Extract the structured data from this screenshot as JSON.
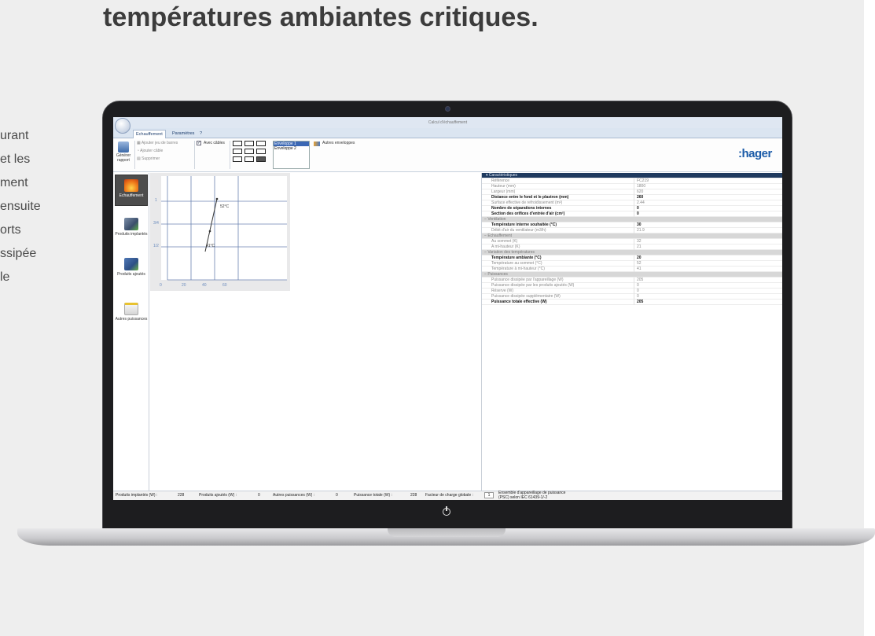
{
  "headline": "températures ambiantes critiques.",
  "left_text": [
    "urant",
    "et les",
    "ment",
    "ensuite",
    "orts",
    "ssipée",
    "le"
  ],
  "app": {
    "window_title": "Calcul d'échauffement",
    "tabs": [
      "Echauffement",
      "Paramètres",
      "?"
    ],
    "ribbon": {
      "generer_rapport": "Générer rapport",
      "ajouter_jeu_barres": "Ajouter jeu de barres",
      "ajouter_cable": "Ajouter câble",
      "supprimer": "Supprimer",
      "avec_cables": "Avec câbles",
      "enveloppes": [
        "Enveloppe 1",
        "Enveloppe 2"
      ],
      "autres_enveloppes": "Autres enveloppes",
      "logo": ":hager"
    },
    "sidebar": [
      {
        "label": "Echauffement",
        "icon": "flame-icon"
      },
      {
        "label": "Produits implantés",
        "icon": "products-implanted-icon"
      },
      {
        "label": "Produits ajoutés",
        "icon": "products-added-icon"
      },
      {
        "label": "Autres puissances",
        "icon": "folder-plus-icon"
      }
    ],
    "chart": {
      "y_ticks": [
        "1",
        "3/4",
        "1/2"
      ],
      "x_ticks": [
        "0",
        "20",
        "40",
        "60"
      ],
      "annotations": [
        "52°C",
        "41°C"
      ]
    },
    "properties": {
      "header": "Caractéristiques",
      "rows": [
        {
          "type": "item",
          "label": "Référence",
          "value": "FC219"
        },
        {
          "type": "item",
          "label": "Hauteur (mm)",
          "value": "1800"
        },
        {
          "type": "item",
          "label": "Largeur (mm)",
          "value": "620"
        },
        {
          "type": "bold",
          "label": "Distance entre le fond et le plastron (mm)",
          "value": "260"
        },
        {
          "type": "item",
          "label": "Surface effective de refroidissement (m²)",
          "value": "2.44"
        },
        {
          "type": "bold",
          "label": "Nombre de séparations internes",
          "value": "0"
        },
        {
          "type": "bold",
          "label": "Section des orifices d'entrée d'air (cm²)",
          "value": "0"
        },
        {
          "type": "section",
          "label": "Ventilation"
        },
        {
          "type": "bold",
          "label": "Température interne souhaitée (°C)",
          "value": "30"
        },
        {
          "type": "item",
          "label": "Débit d'air du ventilateur (m3/h)",
          "value": "21.9"
        },
        {
          "type": "section",
          "label": "Echauffement"
        },
        {
          "type": "item",
          "label": "Au sommet (K)",
          "value": "32"
        },
        {
          "type": "item",
          "label": "A mi-hauteur (K)",
          "value": "21"
        },
        {
          "type": "section",
          "label": "Variation des températures"
        },
        {
          "type": "bold",
          "label": "Température ambiante (°C)",
          "value": "20"
        },
        {
          "type": "item",
          "label": "Température au sommet (°C)",
          "value": "52"
        },
        {
          "type": "item",
          "label": "Température à mi-hauteur (°C)",
          "value": "41"
        },
        {
          "type": "section",
          "label": "Puissances"
        },
        {
          "type": "item",
          "label": "Puissance dissipée par l'appareillage (W)",
          "value": "205"
        },
        {
          "type": "item",
          "label": "Puissance dissipée par les produits ajoutés (W)",
          "value": "0"
        },
        {
          "type": "item",
          "label": "Réserve (W)",
          "value": "0"
        },
        {
          "type": "item",
          "label": "Puissance dissipée supplémentaire (W)",
          "value": "0"
        },
        {
          "type": "bold",
          "label": "Puissance totale effective (W)",
          "value": "205"
        }
      ]
    },
    "status": {
      "produits_implantes_label": "Produits implantés (W) :",
      "produits_implantes_value": "228",
      "produits_ajoutes_label": "Produits ajoutés (W) :",
      "produits_ajoutes_value": "0",
      "autres_label": "Autres puissances (W) :",
      "autres_value": "0",
      "totale_label": "Puissance totale (W) :",
      "totale_value": "228",
      "facteur_label": "Facteur de charge globale :",
      "facteur_value": "1",
      "norme_line1": "Ensemble d'appareillage de puissance",
      "norme_line2": "(PSC) selon IEC 61439-1/-2"
    }
  }
}
